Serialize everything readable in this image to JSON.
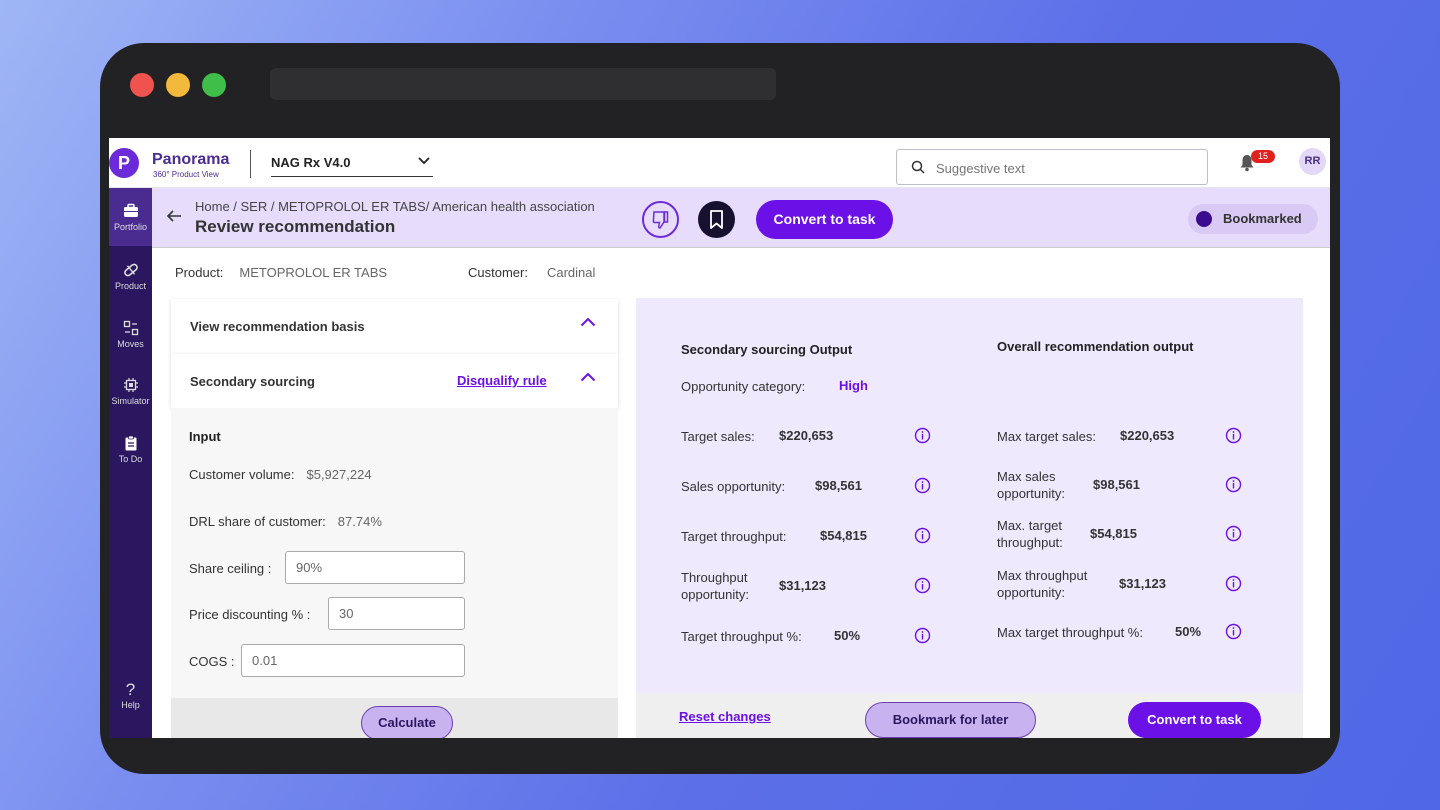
{
  "app": {
    "brand_name": "Panorama",
    "brand_sub": "360° Product View",
    "logo_letter": "P",
    "selected_version": "NAG Rx V4.0",
    "search_placeholder": "Suggestive text",
    "notification_count": "15",
    "avatar_initials": "RR"
  },
  "sidebar": {
    "items": [
      {
        "label": "Portfolio",
        "icon": "briefcase-icon"
      },
      {
        "label": "Product",
        "icon": "pill-icon"
      },
      {
        "label": "Moves",
        "icon": "moves-icon"
      },
      {
        "label": "Simulator",
        "icon": "chip-icon"
      },
      {
        "label": "To Do",
        "icon": "clipboard-icon"
      }
    ],
    "help_label": "Help"
  },
  "header": {
    "breadcrumb": "Home / SER / METOPROLOL ER TABS/ American health association",
    "title": "Review recommendation",
    "convert_label": "Convert to task",
    "bookmarked_label": "Bookmarked"
  },
  "context": {
    "product_label": "Product:",
    "product_value": "METOPROLOL ER TABS",
    "customer_label": "Customer:",
    "customer_value": "Cardinal"
  },
  "left": {
    "acc1_title": "View recommendation basis",
    "acc2_title": "Secondary sourcing",
    "disqualify_label": "Disqualify rule",
    "input_title": "Input",
    "customer_volume_label": "Customer volume:",
    "customer_volume_value": "$5,927,224",
    "drl_share_label": "DRL share of customer:",
    "drl_share_value": "87.74%",
    "share_ceiling_label": "Share ceiling :",
    "share_ceiling_value": "90%",
    "price_discounting_label": "Price discounting % :",
    "price_discounting_value": "30",
    "cogs_label": "COGS :",
    "cogs_value": "0.01",
    "calculate_label": "Calculate"
  },
  "right": {
    "secondary_heading": "Secondary sourcing  Output",
    "overall_heading": "Overall recommendation output",
    "opportunity_label": "Opportunity category:",
    "opportunity_value": "High",
    "secondary": [
      {
        "label": "Target sales:",
        "value": "$220,653"
      },
      {
        "label": "Sales opportunity:",
        "value": "$98,561"
      },
      {
        "label": "Target throughput:",
        "value": "$54,815"
      },
      {
        "label": "Throughput\nopportunity:",
        "value": "$31,123"
      },
      {
        "label": "Target throughput %:",
        "value": "50%"
      }
    ],
    "overall": [
      {
        "label": "Max target sales:",
        "value": "$220,653"
      },
      {
        "label": "Max sales\nopportunity:",
        "value": "$98,561"
      },
      {
        "label": "Max. target\nthroughput:",
        "value": "$54,815"
      },
      {
        "label": "Max throughput\nopportunity:",
        "value": "$31,123"
      },
      {
        "label": "Max target throughput %:",
        "value": "50%"
      }
    ],
    "reset_label": "Reset changes",
    "bookmark_later_label": "Bookmark for later",
    "convert_label": "Convert to task"
  },
  "colors": {
    "accent": "#6b10e6",
    "sidebar": "#2b1660",
    "header": "#e7dcfb",
    "output_panel": "#efe9fd"
  }
}
